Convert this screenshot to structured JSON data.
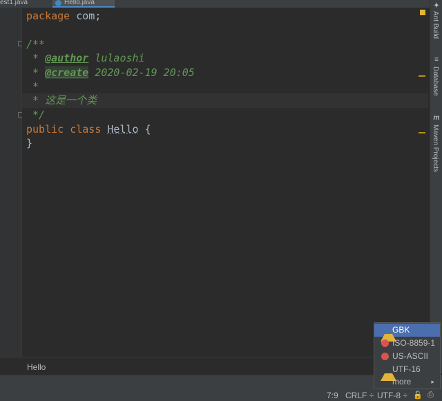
{
  "tabs": [
    {
      "label": "est1.java"
    },
    {
      "label": "Hello.java"
    }
  ],
  "code": {
    "line1": {
      "kw": "package",
      "text": " com;"
    },
    "line2": "/**",
    "line3": {
      "prefix": " * ",
      "tag": "@author",
      "value": " lulaoshi"
    },
    "line4": {
      "prefix": " * ",
      "tag": "@create",
      "value": " 2020-02-19 20:05"
    },
    "line5": " *",
    "line6": " * 这是一个类",
    "line7": " */",
    "line8": {
      "kw1": "public",
      "kw2": "class",
      "name": "Hello",
      "brace": " {"
    },
    "line9": "}"
  },
  "breadcrumb": "Hello",
  "right_tools": [
    {
      "label": "Ant Build",
      "icon": "ant-icon"
    },
    {
      "label": "Database",
      "icon": "database-icon"
    },
    {
      "label": "Maven Projects",
      "icon": "maven-icon",
      "glyph": "m"
    }
  ],
  "status": {
    "position": "7:9",
    "line_separator": "CRLF",
    "line_separator_arrow": "÷",
    "encoding": "UTF-8",
    "encoding_arrow": "÷"
  },
  "encoding_popup": {
    "options": [
      {
        "label": "GBK",
        "icon": "warning-icon",
        "selected": true
      },
      {
        "label": "ISO-8859-1",
        "icon": "error-icon"
      },
      {
        "label": "US-ASCII",
        "icon": "error-icon"
      },
      {
        "label": "UTF-16",
        "icon": "warning-icon"
      },
      {
        "label": "more",
        "icon": "chevron-right-icon",
        "arrow": "▸"
      }
    ]
  },
  "colors": {
    "editor_bg": "#2b2b2b",
    "keyword": "#cc7832",
    "doc_comment": "#629755",
    "selection": "#4b6eaf",
    "warning": "#e2b43a",
    "error": "#d9534f"
  }
}
